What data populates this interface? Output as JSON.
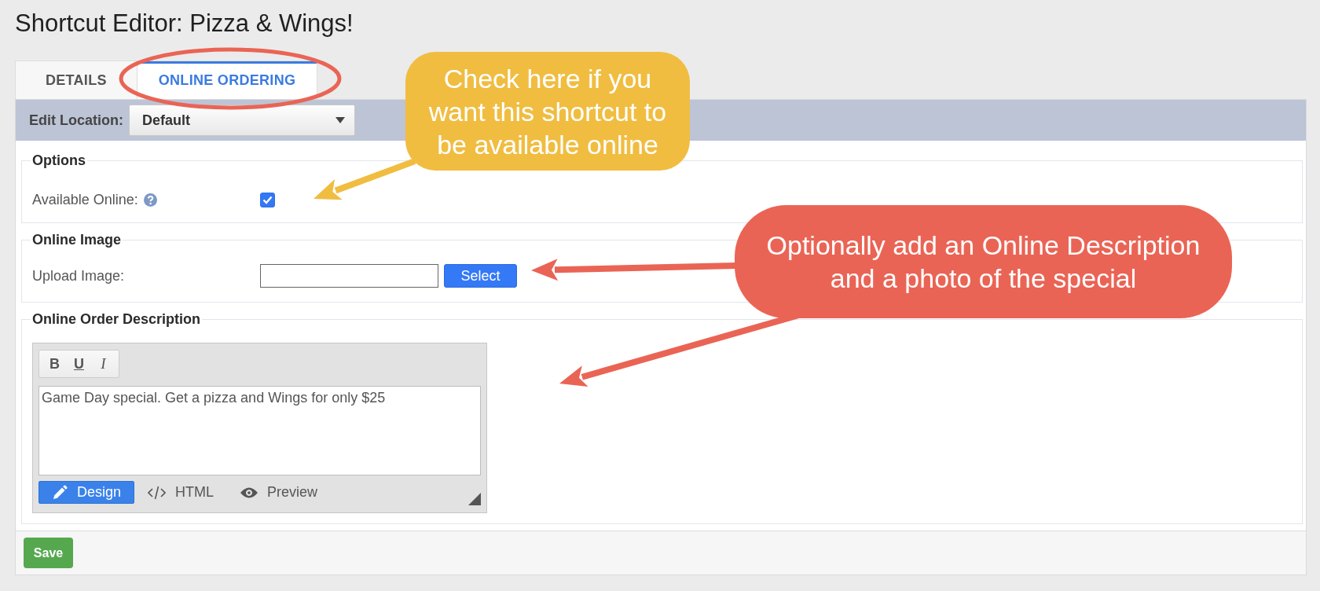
{
  "page": {
    "title": "Shortcut Editor: Pizza & Wings!"
  },
  "tabs": [
    {
      "label": "DETAILS",
      "selected": false
    },
    {
      "label": "ONLINE ORDERING",
      "selected": true
    }
  ],
  "location_bar": {
    "label": "Edit Location:",
    "value": "Default"
  },
  "sections": [
    {
      "legend": "Options",
      "kind": "checkbox",
      "label": "Available Online:",
      "help": true,
      "checked": true
    },
    {
      "legend": "Online Image",
      "kind": "upload",
      "label": "Upload Image:",
      "button": "Select"
    },
    {
      "legend": "Online Order Description",
      "kind": "editor",
      "format_buttons": [
        {
          "label": "B",
          "kind": "bold"
        },
        {
          "label": "U",
          "kind": "underline"
        },
        {
          "label": "I",
          "kind": "italic"
        }
      ],
      "value": "Game Day special. Get a pizza and Wings for only $25",
      "modes": [
        {
          "label": "Design",
          "selected": true
        },
        {
          "label": "HTML",
          "selected": false
        },
        {
          "label": "Preview",
          "selected": false
        }
      ]
    }
  ],
  "footer": {
    "save_button": "Save"
  },
  "callouts": [
    {
      "text": "Check here if you want this shortcut to be available online",
      "color": "#f0bd41"
    },
    {
      "text": "Optionally add an Online Description and a photo of the special",
      "color": "#ea6455"
    }
  ]
}
